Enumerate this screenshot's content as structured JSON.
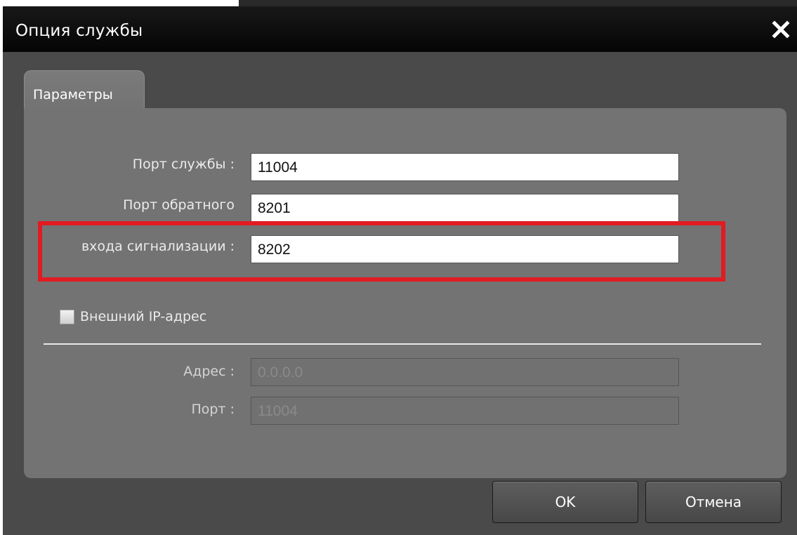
{
  "window": {
    "title": "Опция службы"
  },
  "tabs": [
    {
      "label": "Параметры"
    }
  ],
  "fields": {
    "service_port": {
      "label": "Порт службы :",
      "value": "11004"
    },
    "callback_port": {
      "label_line1": "Порт обратного",
      "label_line2": "входа сигнализации :",
      "value": "8201"
    },
    "alarm_port": {
      "value": "8202"
    }
  },
  "external_ip": {
    "checkbox_label": "Внешний IP-адрес",
    "checked": false,
    "address": {
      "label": "Адрес :",
      "value": "0.0.0.0"
    },
    "port": {
      "label": "Порт :",
      "value": "11004"
    }
  },
  "buttons": {
    "ok": "OK",
    "cancel": "Отмена"
  },
  "colors": {
    "highlight": "#e11b22",
    "titlebar": "#0b0b0b",
    "panel": "#737373"
  }
}
